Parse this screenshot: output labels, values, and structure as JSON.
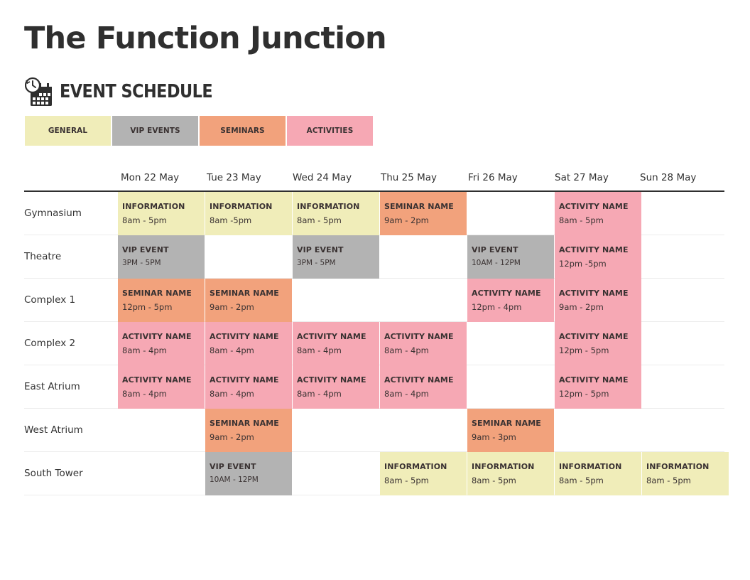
{
  "header": {
    "title": "The Function Junction",
    "subtitle": "EVENT SCHEDULE",
    "subtitle_icon": "calendar-clock-icon"
  },
  "colors": {
    "general": "#f0edb9",
    "vip": "#b3b3b3",
    "seminar": "#f2a27c",
    "activity": "#f6a8b4",
    "text": "#2f2f2f"
  },
  "legend": [
    {
      "key": "general",
      "label": "GENERAL"
    },
    {
      "key": "vip",
      "label": "VIP EVENTS"
    },
    {
      "key": "seminar",
      "label": "SEMINARS"
    },
    {
      "key": "activity",
      "label": "ACTIVITIES"
    }
  ],
  "schedule": {
    "days": [
      "Mon 22 May",
      "Tue 23 May",
      "Wed 24 May",
      "Thu 25 May",
      "Fri 26 May",
      "Sat 27 May",
      "Sun 28 May"
    ],
    "rows": [
      {
        "venue": "Gymnasium",
        "cells": [
          {
            "type": "general",
            "name": "INFORMATION",
            "time": "8am - 5pm"
          },
          {
            "type": "general",
            "name": "INFORMATION",
            "time": "8am -5pm"
          },
          {
            "type": "general",
            "name": "INFORMATION",
            "time": "8am - 5pm"
          },
          {
            "type": "seminar",
            "name": "SEMINAR NAME",
            "time": "9am - 2pm"
          },
          null,
          {
            "type": "activity",
            "name": "ACTIVITY NAME",
            "time": "8am - 5pm"
          },
          null
        ]
      },
      {
        "venue": "Theatre",
        "cells": [
          {
            "type": "vip",
            "name": "VIP EVENT",
            "time": "3PM - 5PM"
          },
          null,
          {
            "type": "vip",
            "name": "VIP EVENT",
            "time": "3PM - 5PM"
          },
          null,
          {
            "type": "vip",
            "name": "VIP EVENT",
            "time": "10AM - 12PM"
          },
          {
            "type": "activity",
            "name": "ACTIVITY NAME",
            "time": "12pm -5pm"
          },
          null
        ]
      },
      {
        "venue": "Complex 1",
        "cells": [
          {
            "type": "seminar",
            "name": "SEMINAR NAME",
            "time": "12pm - 5pm"
          },
          {
            "type": "seminar",
            "name": "SEMINAR NAME",
            "time": "9am - 2pm"
          },
          null,
          null,
          {
            "type": "activity",
            "name": "ACTIVITY NAME",
            "time": "12pm - 4pm"
          },
          {
            "type": "activity",
            "name": "ACTIVITY NAME",
            "time": "9am - 2pm"
          },
          null
        ]
      },
      {
        "venue": "Complex 2",
        "cells": [
          {
            "type": "activity",
            "name": "ACTIVITY NAME",
            "time": "8am - 4pm"
          },
          {
            "type": "activity",
            "name": "ACTIVITY NAME",
            "time": "8am - 4pm"
          },
          {
            "type": "activity",
            "name": "ACTIVITY NAME",
            "time": "8am - 4pm"
          },
          {
            "type": "activity",
            "name": "ACTIVITY NAME",
            "time": "8am - 4pm"
          },
          null,
          {
            "type": "activity",
            "name": "ACTIVITY NAME",
            "time": "12pm - 5pm"
          },
          null
        ]
      },
      {
        "venue": "East Atrium",
        "cells": [
          {
            "type": "activity",
            "name": "ACTIVITY NAME",
            "time": "8am - 4pm"
          },
          {
            "type": "activity",
            "name": "ACTIVITY NAME",
            "time": "8am - 4pm"
          },
          {
            "type": "activity",
            "name": "ACTIVITY NAME",
            "time": "8am - 4pm"
          },
          {
            "type": "activity",
            "name": "ACTIVITY NAME",
            "time": "8am - 4pm"
          },
          null,
          {
            "type": "activity",
            "name": "ACTIVITY NAME",
            "time": "12pm - 5pm"
          },
          null
        ]
      },
      {
        "venue": "West Atrium",
        "cells": [
          null,
          {
            "type": "seminar",
            "name": "SEMINAR NAME",
            "time": "9am - 2pm"
          },
          null,
          null,
          {
            "type": "seminar",
            "name": "SEMINAR NAME",
            "time": "9am - 3pm"
          },
          null,
          null
        ]
      },
      {
        "venue": "South Tower",
        "cells": [
          null,
          {
            "type": "vip",
            "name": "VIP EVENT",
            "time": "10AM - 12PM"
          },
          null,
          {
            "type": "general",
            "name": "INFORMATION",
            "time": "8am - 5pm"
          },
          {
            "type": "general",
            "name": "INFORMATION",
            "time": "8am - 5pm"
          },
          {
            "type": "general",
            "name": "INFORMATION",
            "time": "8am - 5pm"
          },
          {
            "type": "general",
            "name": "INFORMATION",
            "time": "8am - 5pm"
          }
        ]
      }
    ]
  }
}
